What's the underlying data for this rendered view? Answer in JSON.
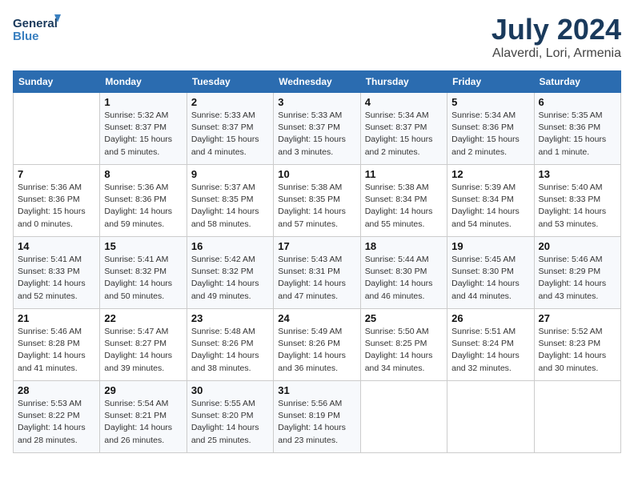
{
  "header": {
    "logo_line1": "General",
    "logo_line2": "Blue",
    "month": "July 2024",
    "location": "Alaverdi, Lori, Armenia"
  },
  "weekdays": [
    "Sunday",
    "Monday",
    "Tuesday",
    "Wednesday",
    "Thursday",
    "Friday",
    "Saturday"
  ],
  "weeks": [
    [
      {
        "day": "",
        "info": ""
      },
      {
        "day": "1",
        "info": "Sunrise: 5:32 AM\nSunset: 8:37 PM\nDaylight: 15 hours\nand 5 minutes."
      },
      {
        "day": "2",
        "info": "Sunrise: 5:33 AM\nSunset: 8:37 PM\nDaylight: 15 hours\nand 4 minutes."
      },
      {
        "day": "3",
        "info": "Sunrise: 5:33 AM\nSunset: 8:37 PM\nDaylight: 15 hours\nand 3 minutes."
      },
      {
        "day": "4",
        "info": "Sunrise: 5:34 AM\nSunset: 8:37 PM\nDaylight: 15 hours\nand 2 minutes."
      },
      {
        "day": "5",
        "info": "Sunrise: 5:34 AM\nSunset: 8:36 PM\nDaylight: 15 hours\nand 2 minutes."
      },
      {
        "day": "6",
        "info": "Sunrise: 5:35 AM\nSunset: 8:36 PM\nDaylight: 15 hours\nand 1 minute."
      }
    ],
    [
      {
        "day": "7",
        "info": "Sunrise: 5:36 AM\nSunset: 8:36 PM\nDaylight: 15 hours\nand 0 minutes."
      },
      {
        "day": "8",
        "info": "Sunrise: 5:36 AM\nSunset: 8:36 PM\nDaylight: 14 hours\nand 59 minutes."
      },
      {
        "day": "9",
        "info": "Sunrise: 5:37 AM\nSunset: 8:35 PM\nDaylight: 14 hours\nand 58 minutes."
      },
      {
        "day": "10",
        "info": "Sunrise: 5:38 AM\nSunset: 8:35 PM\nDaylight: 14 hours\nand 57 minutes."
      },
      {
        "day": "11",
        "info": "Sunrise: 5:38 AM\nSunset: 8:34 PM\nDaylight: 14 hours\nand 55 minutes."
      },
      {
        "day": "12",
        "info": "Sunrise: 5:39 AM\nSunset: 8:34 PM\nDaylight: 14 hours\nand 54 minutes."
      },
      {
        "day": "13",
        "info": "Sunrise: 5:40 AM\nSunset: 8:33 PM\nDaylight: 14 hours\nand 53 minutes."
      }
    ],
    [
      {
        "day": "14",
        "info": "Sunrise: 5:41 AM\nSunset: 8:33 PM\nDaylight: 14 hours\nand 52 minutes."
      },
      {
        "day": "15",
        "info": "Sunrise: 5:41 AM\nSunset: 8:32 PM\nDaylight: 14 hours\nand 50 minutes."
      },
      {
        "day": "16",
        "info": "Sunrise: 5:42 AM\nSunset: 8:32 PM\nDaylight: 14 hours\nand 49 minutes."
      },
      {
        "day": "17",
        "info": "Sunrise: 5:43 AM\nSunset: 8:31 PM\nDaylight: 14 hours\nand 47 minutes."
      },
      {
        "day": "18",
        "info": "Sunrise: 5:44 AM\nSunset: 8:30 PM\nDaylight: 14 hours\nand 46 minutes."
      },
      {
        "day": "19",
        "info": "Sunrise: 5:45 AM\nSunset: 8:30 PM\nDaylight: 14 hours\nand 44 minutes."
      },
      {
        "day": "20",
        "info": "Sunrise: 5:46 AM\nSunset: 8:29 PM\nDaylight: 14 hours\nand 43 minutes."
      }
    ],
    [
      {
        "day": "21",
        "info": "Sunrise: 5:46 AM\nSunset: 8:28 PM\nDaylight: 14 hours\nand 41 minutes."
      },
      {
        "day": "22",
        "info": "Sunrise: 5:47 AM\nSunset: 8:27 PM\nDaylight: 14 hours\nand 39 minutes."
      },
      {
        "day": "23",
        "info": "Sunrise: 5:48 AM\nSunset: 8:26 PM\nDaylight: 14 hours\nand 38 minutes."
      },
      {
        "day": "24",
        "info": "Sunrise: 5:49 AM\nSunset: 8:26 PM\nDaylight: 14 hours\nand 36 minutes."
      },
      {
        "day": "25",
        "info": "Sunrise: 5:50 AM\nSunset: 8:25 PM\nDaylight: 14 hours\nand 34 minutes."
      },
      {
        "day": "26",
        "info": "Sunrise: 5:51 AM\nSunset: 8:24 PM\nDaylight: 14 hours\nand 32 minutes."
      },
      {
        "day": "27",
        "info": "Sunrise: 5:52 AM\nSunset: 8:23 PM\nDaylight: 14 hours\nand 30 minutes."
      }
    ],
    [
      {
        "day": "28",
        "info": "Sunrise: 5:53 AM\nSunset: 8:22 PM\nDaylight: 14 hours\nand 28 minutes."
      },
      {
        "day": "29",
        "info": "Sunrise: 5:54 AM\nSunset: 8:21 PM\nDaylight: 14 hours\nand 26 minutes."
      },
      {
        "day": "30",
        "info": "Sunrise: 5:55 AM\nSunset: 8:20 PM\nDaylight: 14 hours\nand 25 minutes."
      },
      {
        "day": "31",
        "info": "Sunrise: 5:56 AM\nSunset: 8:19 PM\nDaylight: 14 hours\nand 23 minutes."
      },
      {
        "day": "",
        "info": ""
      },
      {
        "day": "",
        "info": ""
      },
      {
        "day": "",
        "info": ""
      }
    ]
  ]
}
